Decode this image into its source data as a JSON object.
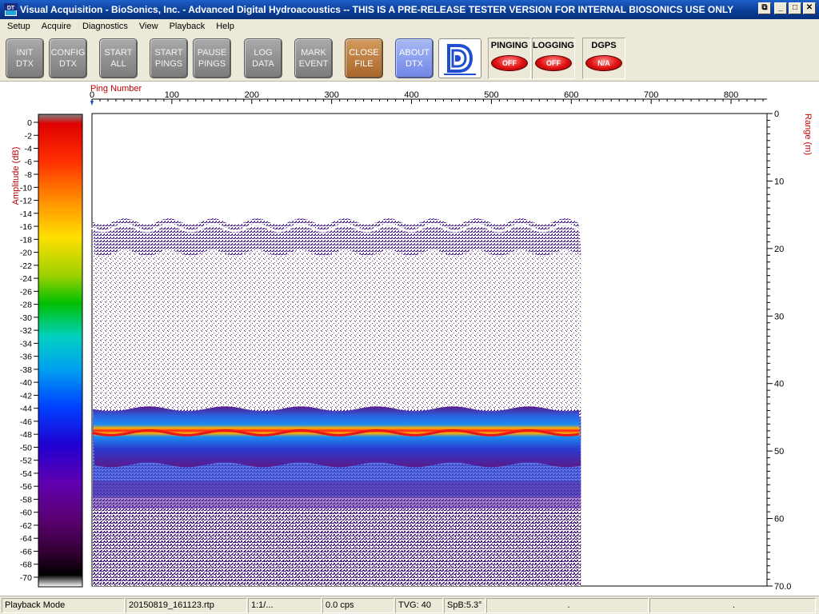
{
  "window": {
    "title": "Visual Acquisition  -  BioSonics, Inc.  -  Advanced Digital Hydroacoustics  -- THIS IS A PRE-RELEASE TESTER VERSION FOR INTERNAL BIOSONICS USE ONLY",
    "app_icon_label": "DT"
  },
  "menu": [
    "Setup",
    "Acquire",
    "Diagnostics",
    "View",
    "Playback",
    "Help"
  ],
  "toolbar": {
    "buttons": [
      {
        "label": "INIT\nDTX"
      },
      {
        "label": "CONFIG\nDTX"
      },
      {
        "label": "START\nALL"
      },
      {
        "label": "START\nPINGS"
      },
      {
        "label": "PAUSE\nPINGS"
      },
      {
        "label": "LOG\nDATA"
      },
      {
        "label": "MARK\nEVENT"
      },
      {
        "label": "CLOSE\nFILE"
      },
      {
        "label": "ABOUT\nDTX"
      }
    ],
    "logo_icon": "biosonics-logo-icon",
    "indicators": [
      {
        "label": "PINGING",
        "state": "OFF"
      },
      {
        "label": "LOGGING",
        "state": "OFF"
      },
      {
        "label": "DGPS",
        "state": "N/A"
      }
    ]
  },
  "echogram": {
    "x_axis_label": "Ping Number",
    "y_axis_label": "Range (m)",
    "colorbar_label": "Amplitude (dB)",
    "x_ticks": [
      "0",
      "100",
      "200",
      "300",
      "400",
      "500",
      "600",
      "700",
      "800"
    ],
    "y_ticks": [
      "0",
      "10",
      "20",
      "30",
      "40",
      "50",
      "60",
      "70.0"
    ],
    "colorbar_ticks": [
      "0",
      "-2",
      "-4",
      "-6",
      "-8",
      "-10",
      "-12",
      "-14",
      "-16",
      "-18",
      "-20",
      "-22",
      "-24",
      "-26",
      "-28",
      "-30",
      "-32",
      "-34",
      "-36",
      "-38",
      "-40",
      "-42",
      "-44",
      "-46",
      "-48",
      "-50",
      "-52",
      "-54",
      "-56",
      "-58",
      "-60",
      "-62",
      "-64",
      "-66",
      "-68",
      "-70"
    ],
    "x_range": [
      0,
      845
    ],
    "y_range": [
      0,
      70
    ],
    "amplitude_range": [
      0,
      -70
    ],
    "pings_displayed": 612,
    "surface_band_depth_m": [
      16,
      19
    ],
    "bottom_depth_m": 47.3,
    "colors": {
      "bottom_line": "#e81818",
      "axis_label": "#c00000"
    }
  },
  "status": {
    "mode": "Playback Mode",
    "file": "20150819_161123.rtp",
    "ratio": "1:1/...",
    "rate": "0.0 cps",
    "tvg": "TVG: 40",
    "spb": "SpB:5.3°",
    "pane7": ".",
    "pane8": "."
  }
}
